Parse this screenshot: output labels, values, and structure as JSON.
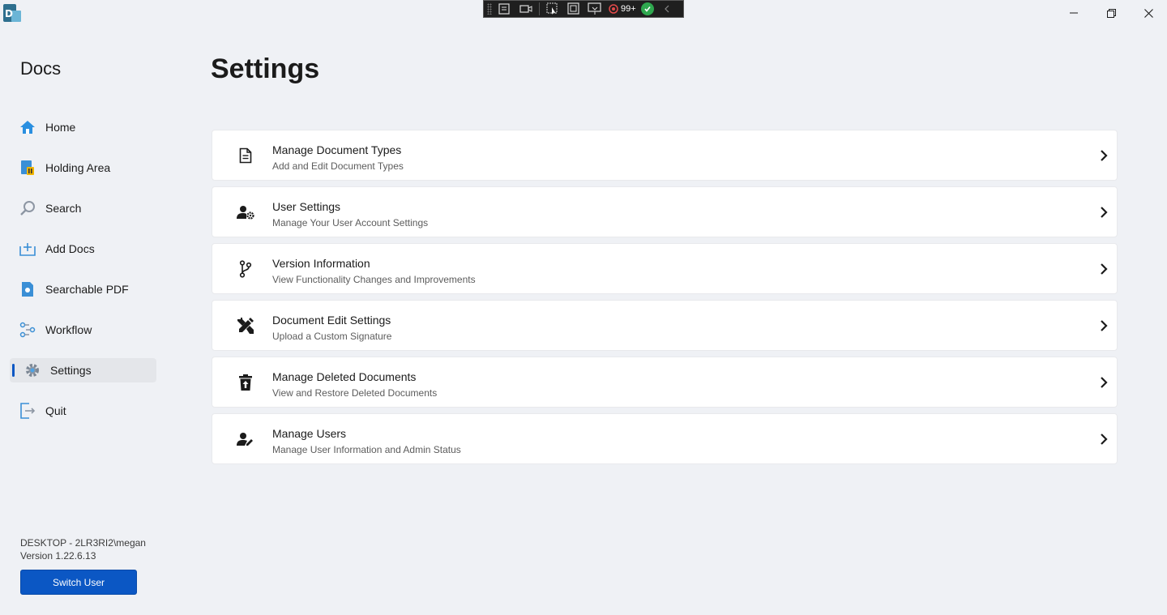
{
  "app": {
    "brand": "Docs",
    "page_title": "Settings"
  },
  "debug_toolbar": {
    "counter": "99+"
  },
  "sidebar": {
    "items": [
      {
        "label": "Home",
        "icon": "home-icon"
      },
      {
        "label": "Holding Area",
        "icon": "holding-area-icon"
      },
      {
        "label": "Search",
        "icon": "search-icon"
      },
      {
        "label": "Add Docs",
        "icon": "add-docs-icon"
      },
      {
        "label": "Searchable PDF",
        "icon": "searchable-pdf-icon"
      },
      {
        "label": "Workflow",
        "icon": "workflow-icon"
      },
      {
        "label": "Settings",
        "icon": "gear-icon",
        "active": true
      },
      {
        "label": "Quit",
        "icon": "quit-icon"
      }
    ],
    "user": "DESKTOP - 2LR3RI2\\megan",
    "version": "Version 1.22.6.13",
    "switch_user_label": "Switch User"
  },
  "settings": {
    "items": [
      {
        "title": "Manage Document Types",
        "subtitle": "Add and Edit Document Types",
        "icon": "document-icon"
      },
      {
        "title": "User Settings",
        "subtitle": "Manage Your User Account Settings",
        "icon": "user-gear-icon"
      },
      {
        "title": "Version Information",
        "subtitle": "View Functionality Changes and Improvements",
        "icon": "branch-icon"
      },
      {
        "title": "Document Edit Settings",
        "subtitle": "Upload a Custom Signature",
        "icon": "edit-tools-icon"
      },
      {
        "title": "Manage Deleted Documents",
        "subtitle": "View and Restore Deleted Documents",
        "icon": "trash-restore-icon"
      },
      {
        "title": "Manage Users",
        "subtitle": "Manage User Information and Admin Status",
        "icon": "user-edit-icon"
      }
    ]
  },
  "colors": {
    "background": "#eff1f5",
    "accent": "#0b57c4",
    "card": "#ffffff"
  }
}
